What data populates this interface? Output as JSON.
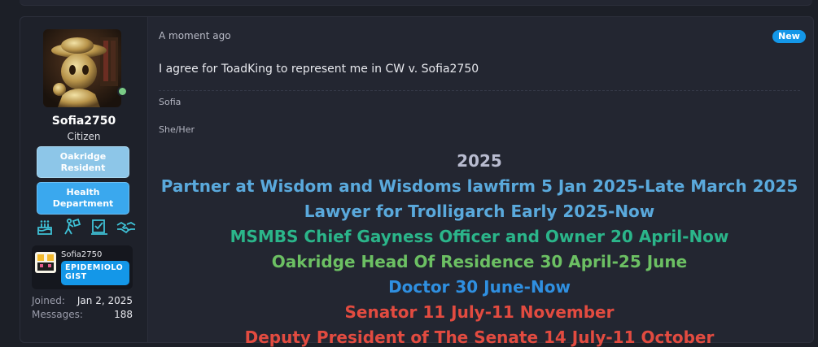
{
  "user": {
    "username": "Sofia2750",
    "title": "Citizen",
    "badges": [
      "Oakridge Resident",
      "Health Department"
    ],
    "trophies": [
      "cake-icon",
      "worker-icon",
      "checklist-icon",
      "handshake-icon"
    ],
    "banner": {
      "name": "Sofia2750",
      "tag": "EPIDEMIOLO GIST"
    },
    "stats": [
      {
        "label": "Joined:",
        "value": "Jan 2, 2025"
      },
      {
        "label": "Messages:",
        "value": "188"
      }
    ]
  },
  "post": {
    "timestamp": "A moment ago",
    "new_label": "New",
    "message": "I agree for ToadKing to represent me in CW v. Sofia2750"
  },
  "signature": {
    "name": "Sofia",
    "pronouns": "She/Her",
    "heading": "2025",
    "roles": [
      {
        "text": "Partner at Wisdom and Wisdoms lawfirm 5 Jan 2025-Late March 2025",
        "color": "#5aa9dc"
      },
      {
        "text": "Lawyer for Trolligarch Early 2025-Now",
        "color": "#5aa9dc"
      },
      {
        "text": "MSMBS Chief Gayness Officer and Owner 20 April-Now",
        "color": "#2bb58a"
      },
      {
        "text": "Oakridge Head Of Residence 30 April-25 June",
        "color": "#6cc063"
      },
      {
        "text": "Doctor 30 June-Now",
        "color": "#2f8fe0"
      },
      {
        "text": "Senator 11 July-11 November",
        "color": "#e24b40"
      },
      {
        "text": "Deputy President of The Senate 14 July-11 October",
        "color": "#e24b40"
      }
    ]
  },
  "colors": {
    "background": "#1c1f27",
    "panel": "#232631",
    "accent": "#1497e8"
  }
}
